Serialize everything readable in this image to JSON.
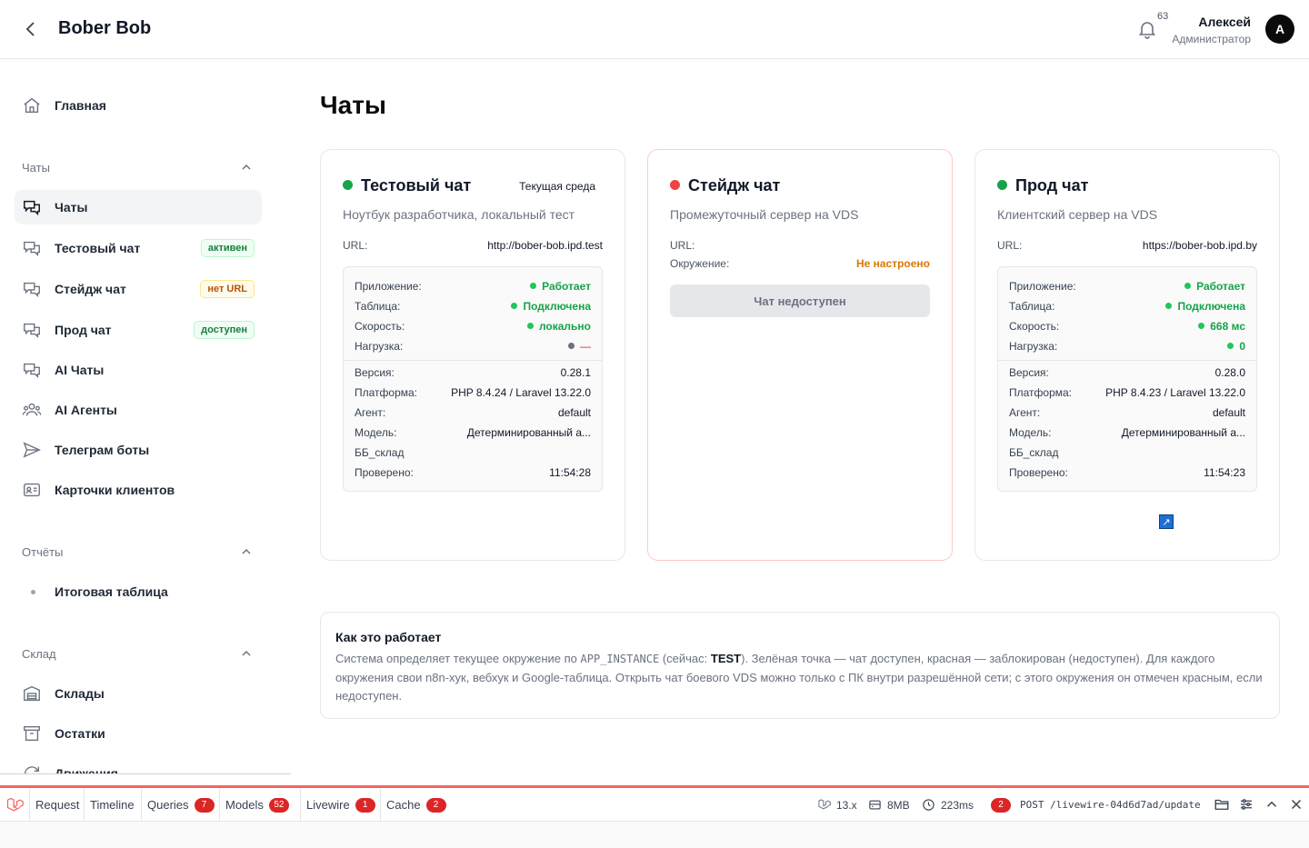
{
  "header": {
    "title": "Bober Bob",
    "notifications_count": "63",
    "user_name": "Алексей",
    "user_role": "Администратор",
    "avatar_letter": "A"
  },
  "sidebar": {
    "home": "Главная",
    "groups": {
      "chats": "Чаты",
      "reports": "Отчёты",
      "warehouse": "Склад"
    },
    "chat_items": [
      {
        "label": "Чаты"
      },
      {
        "label": "Тестовый чат",
        "badge": "активен"
      },
      {
        "label": "Стейдж чат",
        "badge": "нет URL"
      },
      {
        "label": "Прод чат",
        "badge": "доступен"
      },
      {
        "label": "AI Чаты"
      },
      {
        "label": "AI Агенты"
      },
      {
        "label": "Телеграм боты"
      },
      {
        "label": "Карточки клиентов"
      }
    ],
    "report_items": [
      {
        "label": "Итоговая таблица"
      }
    ],
    "warehouse_items": [
      {
        "label": "Склады"
      },
      {
        "label": "Остатки"
      },
      {
        "label": "Движения"
      }
    ]
  },
  "page": {
    "title": "Чаты"
  },
  "cards": [
    {
      "title": "Тестовый чат",
      "env_label": "Текущая среда",
      "subtitle": "Ноутбук разработчика, локальный тест",
      "url_label": "URL:",
      "url": "http://bober-bob.ipd.test",
      "status_color": "#16a34a",
      "rows": {
        "app_k": "Приложение:",
        "app_v": "Работает",
        "table_k": "Таблица:",
        "table_v": "Подключена",
        "speed_k": "Скорость:",
        "speed_v": "локально",
        "load_k": "Нагрузка:",
        "load_v": "—",
        "version_k": "Версия:",
        "version_v": "0.28.1",
        "platform_k": "Платформа:",
        "platform_v": "PHP 8.4.24 / Laravel 13.22.0",
        "agent_k": "Агент:",
        "agent_v": "default",
        "model_k": "Модель:",
        "model_v": "Детерминированный а...",
        "bb_k": "ББ_склад",
        "checked_k": "Проверено:",
        "checked_v": "11:54:28"
      }
    },
    {
      "title": "Стейдж чат",
      "subtitle": "Промежуточный сервер на VDS",
      "url_label": "URL:",
      "env_k": "Окружение:",
      "env_v": "Не настроено",
      "button": "Чат недоступен",
      "status_color": "#ef4444"
    },
    {
      "title": "Прод чат",
      "subtitle": "Клиентский сервер на VDS",
      "url_label": "URL:",
      "url": "https://bober-bob.ipd.by",
      "status_color": "#16a34a",
      "rows": {
        "app_k": "Приложение:",
        "app_v": "Работает",
        "table_k": "Таблица:",
        "table_v": "Подключена",
        "speed_k": "Скорость:",
        "speed_v": "668 мс",
        "load_k": "Нагрузка:",
        "load_v": "0",
        "version_k": "Версия:",
        "version_v": "0.28.0",
        "platform_k": "Платформа:",
        "platform_v": "PHP 8.4.23 / Laravel 13.22.0",
        "agent_k": "Агент:",
        "agent_v": "default",
        "model_k": "Модель:",
        "model_v": "Детерминированный а...",
        "bb_k": "ББ_склад",
        "checked_k": "Проверено:",
        "checked_v": "11:54:23"
      }
    }
  ],
  "how": {
    "title": "Как это работает",
    "p1": "Система определяет текущее окружение по ",
    "code": "APP_INSTANCE",
    "p2": " (сейчас: ",
    "current": "TEST",
    "p3": "). Зелёная точка — чат доступен, красная — заблокирован (недоступен). Для каждого окружения свои n8n-хук, вебхук и Google-таблица. Открыть чат боевого VDS можно только с ПК внутри разрешённой сети; с этого окружения он отмечен красным, если недоступен."
  },
  "debugbar": {
    "tabs": [
      {
        "label": "Request"
      },
      {
        "label": "Timeline"
      },
      {
        "label": "Queries",
        "count": "7"
      },
      {
        "label": "Models",
        "count": "52"
      },
      {
        "label": "Livewire",
        "count": "1"
      },
      {
        "label": "Cache",
        "count": "2"
      }
    ],
    "version": "13.x",
    "memory": "8MB",
    "time": "223ms",
    "req_count": "2",
    "request": "POST /livewire-04d6d7ad/update"
  }
}
